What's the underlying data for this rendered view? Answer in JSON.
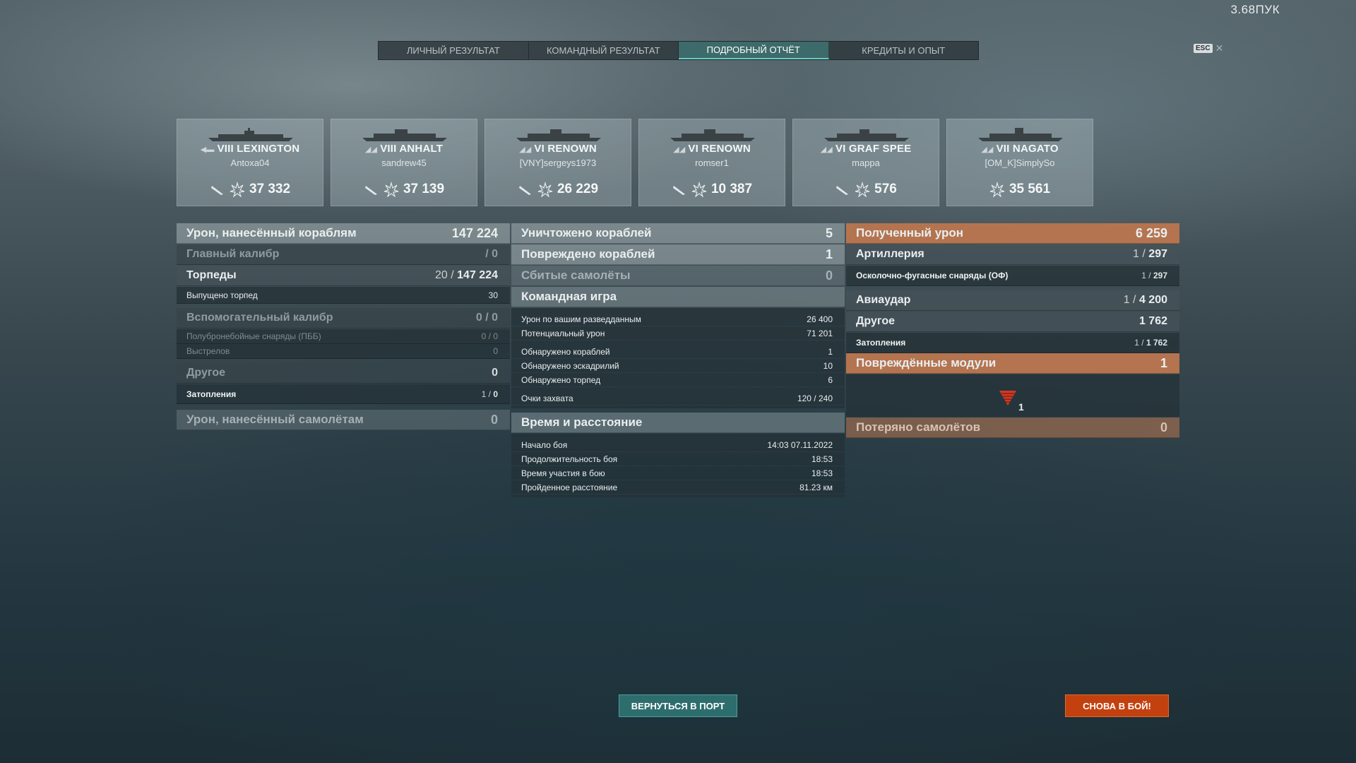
{
  "fps": "3.68ПУК",
  "tabs": [
    {
      "label": "ЛИЧНЫЙ РЕЗУЛЬТАТ",
      "active": false
    },
    {
      "label": "КОМАНДНЫЙ РЕЗУЛЬТАТ",
      "active": false
    },
    {
      "label": "ПОДРОБНЫЙ ОТЧЁТ",
      "active": true
    },
    {
      "label": "КРЕДИТЫ И ОПЫТ",
      "active": false
    }
  ],
  "esc": {
    "key": "ESC",
    "close": "✕"
  },
  "ships": [
    {
      "tier": "VIII",
      "name": "LEXINGTON",
      "player": "Antoxa04",
      "damage": "37 332",
      "icons": [
        "plane-icon",
        "damage-icon"
      ]
    },
    {
      "tier": "VIII",
      "name": "ANHALT",
      "player": "sandrew45",
      "damage": "37 139",
      "icons": [
        "plane-icon",
        "damage-icon"
      ]
    },
    {
      "tier": "VI",
      "name": "RENOWN",
      "player": "[VNY]sergeys1973",
      "damage": "26 229",
      "icons": [
        "plane-icon",
        "damage-icon"
      ]
    },
    {
      "tier": "VI",
      "name": "RENOWN",
      "player": "romser1",
      "damage": "10 387",
      "icons": [
        "plane-icon",
        "damage-icon"
      ]
    },
    {
      "tier": "VI",
      "name": "GRAF SPEE",
      "player": "mappa",
      "damage": "576",
      "icons": [
        "plane-icon",
        "damage-icon"
      ]
    },
    {
      "tier": "VII",
      "name": "NAGATO",
      "player": "[OM_K]SimplySo",
      "damage": "35 561",
      "icons": [
        "damage-icon"
      ]
    }
  ],
  "col1": {
    "ship_damage": {
      "label": "Урон, нанесённый кораблям",
      "value": "147 224"
    },
    "main_caliber": {
      "label": "Главный калибр",
      "value": "/ 0"
    },
    "torpedoes": {
      "label": "Торпеды",
      "hits": "20",
      "value": "147 224"
    },
    "torpedoes_launched": {
      "label": "Выпущено торпед",
      "value": "30"
    },
    "secondary": {
      "label": "Вспомогательный калибр",
      "value": "0 / 0"
    },
    "ap_shells": {
      "label": "Полубронебойные снаряды (ПББ)",
      "value": "0 / 0"
    },
    "shots": {
      "label": "Выстрелов",
      "value": "0"
    },
    "other": {
      "label": "Другое",
      "value": "0"
    },
    "flooding": {
      "label": "Затопления",
      "hits": "1",
      "value": "0"
    },
    "plane_damage": {
      "label": "Урон, нанесённый самолётам",
      "value": "0"
    }
  },
  "col2": {
    "destroyed": {
      "label": "Уничтожено кораблей",
      "value": "5"
    },
    "damaged": {
      "label": "Повреждено кораблей",
      "value": "1"
    },
    "planes_shot": {
      "label": "Сбитые самолёты",
      "value": "0"
    },
    "team_play": {
      "title": "Командная игра",
      "rows1": [
        {
          "label": "Урон по вашим разведданным",
          "value": "26 400"
        },
        {
          "label": "Потенциальный урон",
          "value": "71 201"
        }
      ],
      "rows2": [
        {
          "label": "Обнаружено кораблей",
          "value": "1"
        },
        {
          "label": "Обнаружено эскадрилий",
          "value": "10"
        },
        {
          "label": "Обнаружено торпед",
          "value": "6"
        }
      ],
      "rows3": [
        {
          "label": "Очки захвата",
          "value": "120 / 240"
        }
      ]
    },
    "time_distance": {
      "title": "Время и расстояние",
      "rows": [
        {
          "label": "Начало боя",
          "value": "14:03  07.11.2022"
        },
        {
          "label": "Продолжительность боя",
          "value": "18:53"
        },
        {
          "label": "Время участия в бою",
          "value": "18:53"
        },
        {
          "label": "Пройденное расстояние",
          "value": "81.23 км"
        }
      ]
    }
  },
  "col3": {
    "received": {
      "label": "Полученный урон",
      "value": "6 259"
    },
    "artillery": {
      "label": "Артиллерия",
      "hits": "1",
      "value": "297"
    },
    "he_shells": {
      "label": "Осколочно-фугасные снаряды (ОФ)",
      "hits": "1",
      "value": "297"
    },
    "airstrike": {
      "label": "Авиаудар",
      "hits": "1",
      "value": "4 200"
    },
    "other": {
      "label": "Другое",
      "value": "1 762"
    },
    "flooding": {
      "label": "Затопления",
      "hits": "1",
      "value": "1 762"
    },
    "modules": {
      "label": "Повреждённые модули",
      "value": "1",
      "module_count": "1"
    },
    "planes_lost": {
      "label": "Потеряно самолётов",
      "value": "0"
    }
  },
  "buttons": {
    "port": "ВЕРНУТЬСЯ В ПОРТ",
    "battle": "СНОВА В БОЙ!"
  },
  "colors": {
    "active_tab": "#3d6a6a",
    "received_header": "#b4744f",
    "battle_button": "#c2410f",
    "port_button": "#2e6d6d"
  }
}
